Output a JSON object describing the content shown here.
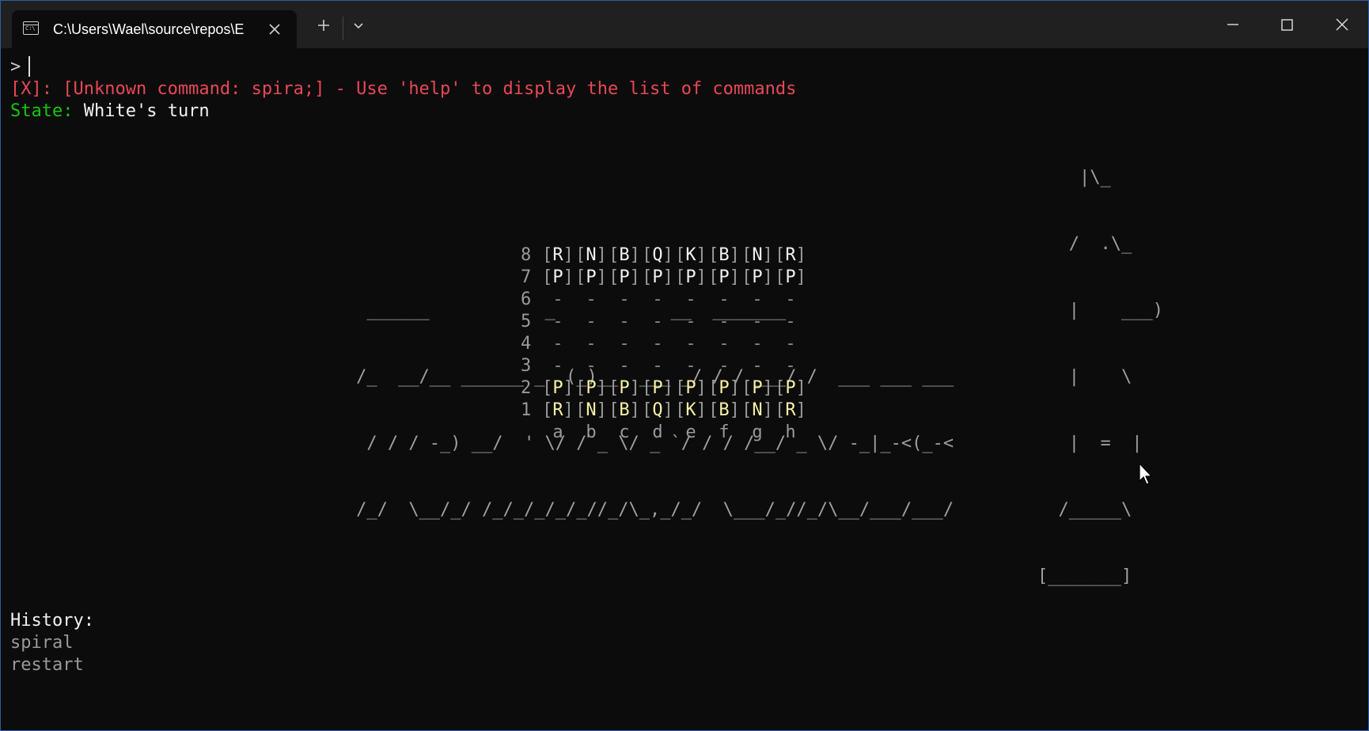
{
  "window": {
    "tab_title": "C:\\Users\\Wael\\source\\repos\\E",
    "tab_icon_text": "C:\\",
    "new_tab_label": "+",
    "dropdown_label": "⌄",
    "accent_color": "#2b5ea8"
  },
  "terminal": {
    "prompt": ">",
    "error_line": "[X]: [Unknown command: spira;] - Use 'help' to display the list of commands",
    "state_label": "State:",
    "state_value": "White's turn",
    "banner_lines": [
      "                                                                                                      |\\_",
      "                                                                                                     /  .\\_",
      "                                  ______           _           __  _______                           |    ___)",
      "                                 /_  __/__ ______ _  (_)__  ___ _/ / / ___/ /  ___ ___ ___           |    \\",
      "                                  / / / -_) __/  ' \\/ / _ \\/ _ `/ / / /__/ _ \\/ -_|_-<(_-<           |  =  |",
      "                                 /_/  \\__/_/ /_/_/_/_/_//_/\\_,_/_/  \\___/_//_/\\__/___/___/          /_____\\",
      "                                                                                                  [_______]"
    ],
    "history_label": "History:",
    "history_items": [
      "spiral",
      "restart"
    ],
    "colors": {
      "error": "#e74856",
      "state_label": "#16c60c",
      "white_pieces": "#f9f1a5",
      "black_pieces": "#f2f2f2"
    }
  },
  "board": {
    "ranks": [
      {
        "rank": "8",
        "cells": [
          "R",
          "N",
          "B",
          "Q",
          "K",
          "B",
          "N",
          "R"
        ],
        "side": "black"
      },
      {
        "rank": "7",
        "cells": [
          "P",
          "P",
          "P",
          "P",
          "P",
          "P",
          "P",
          "P"
        ],
        "side": "black"
      },
      {
        "rank": "6",
        "cells": [
          "-",
          "-",
          "-",
          "-",
          "-",
          "-",
          "-",
          "-"
        ],
        "side": "empty"
      },
      {
        "rank": "5",
        "cells": [
          "-",
          "-",
          "-",
          "-",
          "-",
          "-",
          "-",
          "-"
        ],
        "side": "empty"
      },
      {
        "rank": "4",
        "cells": [
          "-",
          "-",
          "-",
          "-",
          "-",
          "-",
          "-",
          "-"
        ],
        "side": "empty"
      },
      {
        "rank": "3",
        "cells": [
          "-",
          "-",
          "-",
          "-",
          "-",
          "-",
          "-",
          "-"
        ],
        "side": "empty"
      },
      {
        "rank": "2",
        "cells": [
          "P",
          "P",
          "P",
          "P",
          "P",
          "P",
          "P",
          "P"
        ],
        "side": "white"
      },
      {
        "rank": "1",
        "cells": [
          "R",
          "N",
          "B",
          "Q",
          "K",
          "B",
          "N",
          "R"
        ],
        "side": "white"
      }
    ],
    "files": [
      "a",
      "b",
      "c",
      "d",
      "e",
      "f",
      "g",
      "h"
    ]
  }
}
